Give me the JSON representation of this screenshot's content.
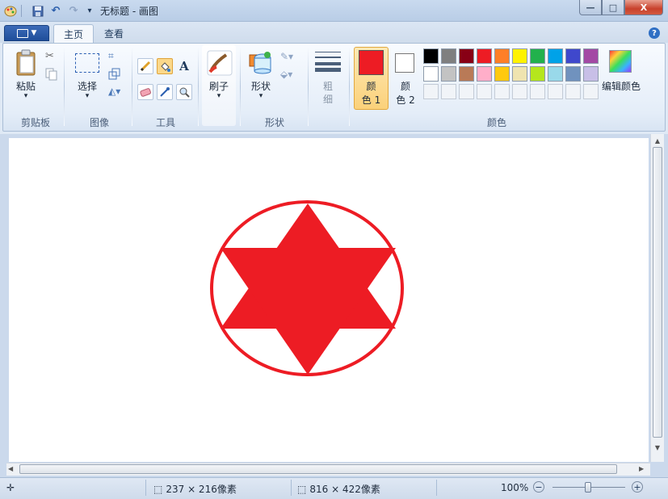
{
  "window": {
    "title": "无标题 - 画图",
    "controls": {
      "minimize": "—",
      "maximize": "□",
      "close": "X"
    }
  },
  "quick_access": [
    {
      "name": "app-icon",
      "glyph": "🎨"
    },
    {
      "name": "save-icon",
      "glyph": "💾"
    },
    {
      "name": "undo-icon",
      "glyph": "↶"
    },
    {
      "name": "redo-icon",
      "glyph": "↷"
    },
    {
      "name": "customize-icon",
      "glyph": "▾"
    }
  ],
  "tabs": {
    "menu_glyph": "▤ ▾",
    "home": "主页",
    "view": "查看",
    "help": "?"
  },
  "ribbon": {
    "clipboard": {
      "label": "剪贴板",
      "paste": "粘贴",
      "dropdown": "▾"
    },
    "image": {
      "label": "图像",
      "select": "选择",
      "dropdown": "▾"
    },
    "tools": {
      "label": "工具",
      "text_glyph": "A",
      "pick_glyph": "🔍"
    },
    "brushes": {
      "label": "刷子"
    },
    "shapes": {
      "label": "形状",
      "shapes_btn": "形状",
      "group_label": "形状"
    },
    "size": {
      "label_line1": "粗",
      "label_line2": "细"
    },
    "colors": {
      "label": "颜色",
      "color1_line1": "颜",
      "color1_line2": "色 1",
      "color2_line1": "颜",
      "color2_line2": "色 2",
      "color1_value": "#ed1c24",
      "color2_value": "#ffffff",
      "edit": "编辑颜色",
      "palette_row1": [
        "#000000",
        "#7f7f7f",
        "#880015",
        "#ed1c24",
        "#ff7f27",
        "#fff200",
        "#22b14c",
        "#00a2e8",
        "#3f48cc",
        "#a349a4"
      ],
      "palette_row2": [
        "#ffffff",
        "#c3c3c3",
        "#b97a57",
        "#ffaec9",
        "#ffc90e",
        "#efe4b0",
        "#b5e61d",
        "#99d9ea",
        "#7092be",
        "#c8bfe7"
      ]
    }
  },
  "canvas": {
    "drawing": {
      "stroke_color": "#ed1c24",
      "fill_color": "#ed1c24",
      "shape": "six-pointed star in circle"
    }
  },
  "status": {
    "selection_size": "237 × 216像素",
    "canvas_size": "816 × 422像素",
    "zoom": "100%",
    "zoom_out": "−",
    "zoom_in": "+"
  }
}
